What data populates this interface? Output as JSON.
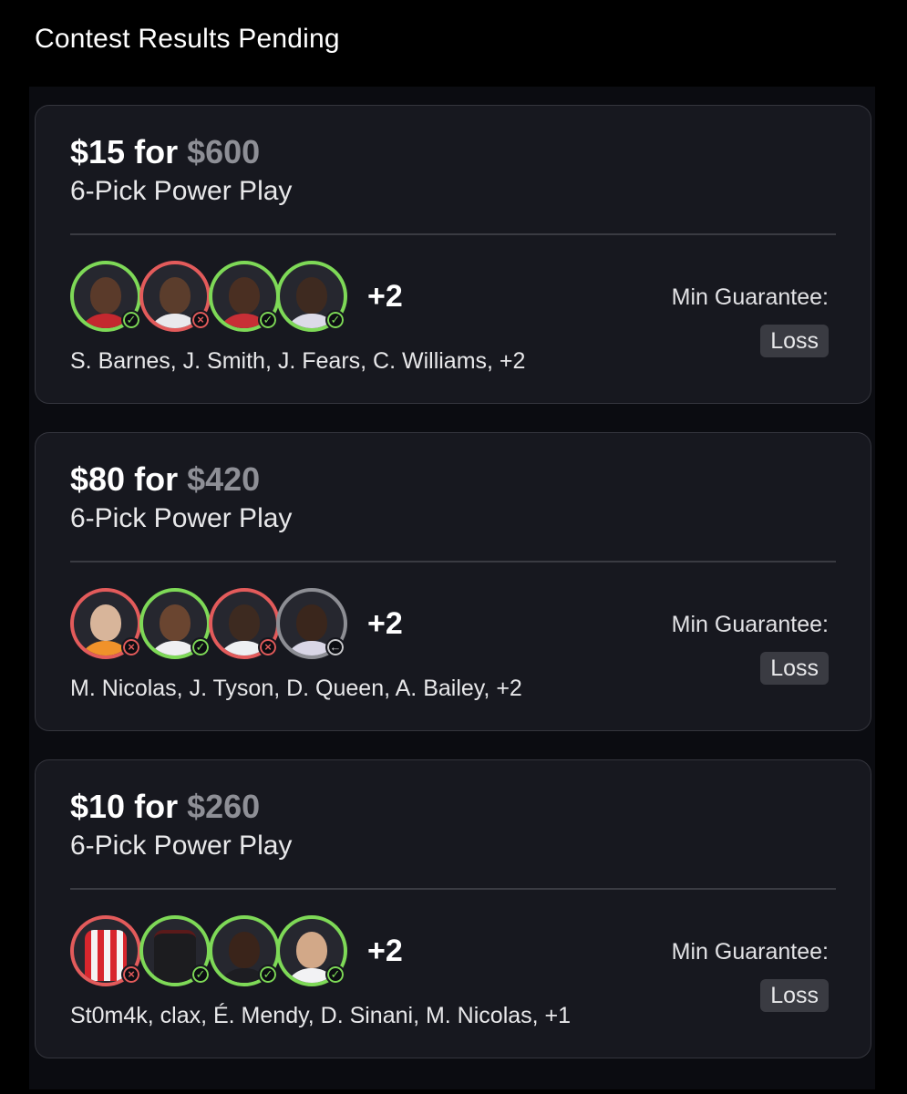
{
  "header": {
    "title": "Contest Results Pending"
  },
  "colors": {
    "win": "#7ed957",
    "loss": "#e35b5b",
    "pending": "#8d8e94",
    "card_bg": "#17181f"
  },
  "cards": [
    {
      "entry": "$15",
      "for_word": "for",
      "payout": "$600",
      "play_type": "6-Pick Power Play",
      "picks": [
        {
          "status": "win",
          "status_icon": "check-icon"
        },
        {
          "status": "loss",
          "status_icon": "x-icon"
        },
        {
          "status": "win",
          "status_icon": "check-icon"
        },
        {
          "status": "win",
          "status_icon": "check-icon"
        }
      ],
      "more": "+2",
      "names": "S. Barnes, J. Smith, J. Fears, C. Williams, +2",
      "min_label": "Min Guarantee:",
      "min_value": "Loss"
    },
    {
      "entry": "$80",
      "for_word": "for",
      "payout": "$420",
      "play_type": "6-Pick Power Play",
      "picks": [
        {
          "status": "loss",
          "status_icon": "x-icon"
        },
        {
          "status": "win",
          "status_icon": "check-icon"
        },
        {
          "status": "loss",
          "status_icon": "x-icon"
        },
        {
          "status": "pending",
          "status_icon": "arrow-left-icon"
        }
      ],
      "more": "+2",
      "names": "M. Nicolas, J. Tyson, D. Queen, A. Bailey, +2",
      "min_label": "Min Guarantee:",
      "min_value": "Loss"
    },
    {
      "entry": "$10",
      "for_word": "for",
      "payout": "$260",
      "play_type": "6-Pick Power Play",
      "picks": [
        {
          "status": "loss",
          "status_icon": "x-icon"
        },
        {
          "status": "win",
          "status_icon": "check-icon"
        },
        {
          "status": "win",
          "status_icon": "check-icon"
        },
        {
          "status": "win",
          "status_icon": "check-icon"
        }
      ],
      "more": "+2",
      "names": "St0m4k, clax, É. Mendy, D. Sinani, M. Nicolas, +1",
      "min_label": "Min Guarantee:",
      "min_value": "Loss"
    }
  ]
}
